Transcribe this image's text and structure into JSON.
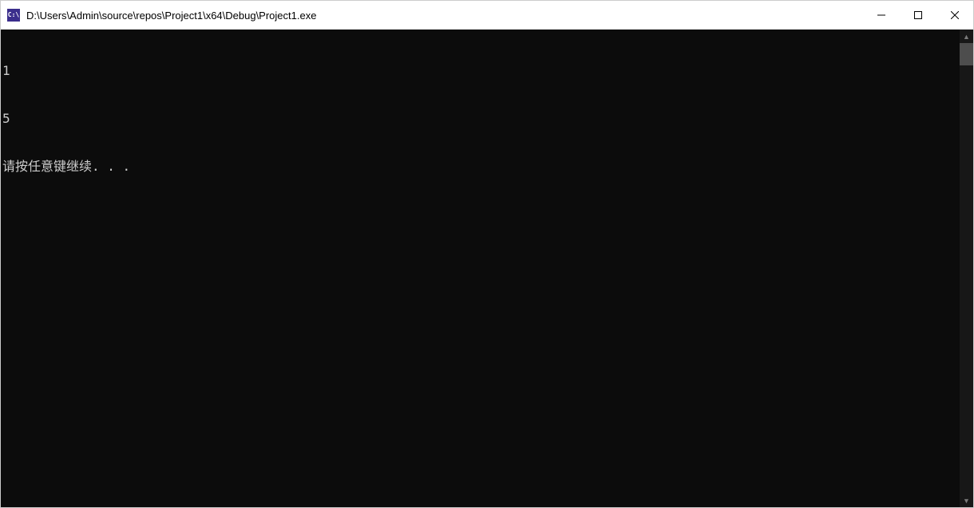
{
  "titlebar": {
    "icon_text": "C:\\",
    "title": "D:\\Users\\Admin\\source\\repos\\Project1\\x64\\Debug\\Project1.exe"
  },
  "console": {
    "lines": [
      "1",
      "5",
      "请按任意键继续. . ."
    ]
  }
}
